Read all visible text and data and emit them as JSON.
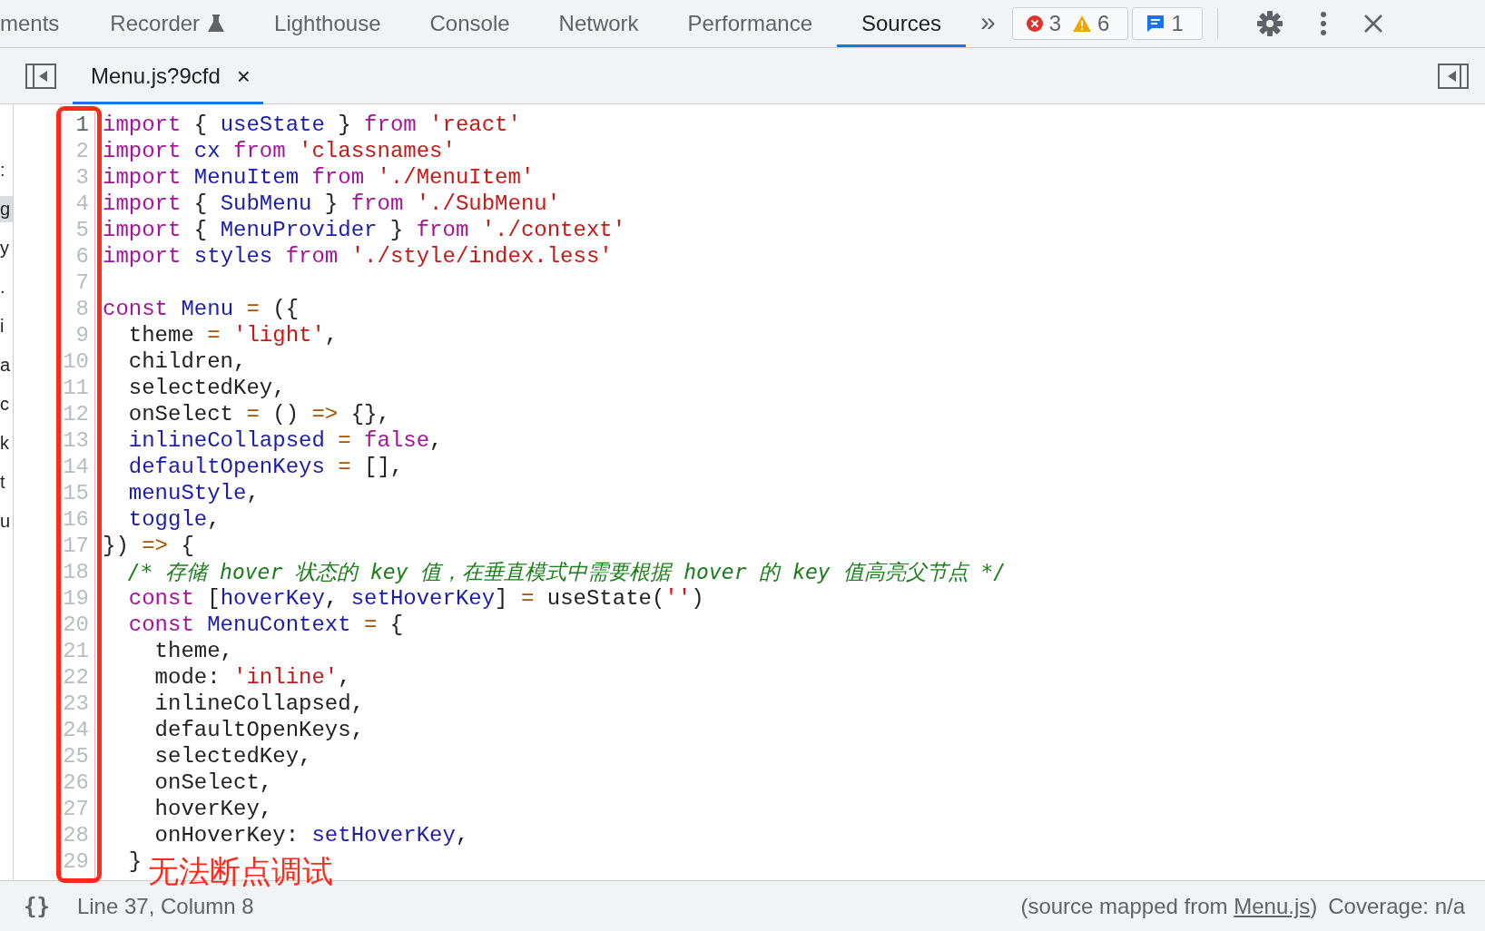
{
  "top_tabs": [
    {
      "label": "ments",
      "kind": "text",
      "selected": false
    },
    {
      "label": "Recorder",
      "kind": "flask",
      "selected": false
    },
    {
      "label": "Lighthouse",
      "kind": "text",
      "selected": false
    },
    {
      "label": "Console",
      "kind": "text",
      "selected": false
    },
    {
      "label": "Network",
      "kind": "text",
      "selected": false
    },
    {
      "label": "Performance",
      "kind": "text",
      "selected": false
    },
    {
      "label": "Sources",
      "kind": "text",
      "selected": true
    }
  ],
  "more_tabs": "»",
  "issues": {
    "errors": "3",
    "warnings": "6",
    "messages": "1"
  },
  "file_tabs": [
    {
      "label": "Menu.js?9cfd",
      "close": "×",
      "selected": true
    }
  ],
  "navigator_fragments": [
    {
      "text": ":",
      "selected": false
    },
    {
      "text": "g",
      "selected": true
    },
    {
      "text": "y",
      "selected": false
    },
    {
      "text": ".",
      "selected": false
    },
    {
      "text": "i",
      "selected": false
    },
    {
      "text": "a",
      "selected": false
    },
    {
      "text": "c",
      "selected": false
    },
    {
      "text": "k",
      "selected": false
    },
    {
      "text": "t",
      "selected": false
    },
    {
      "text": "u",
      "selected": false
    }
  ],
  "code_lines": [
    {
      "number": "1",
      "current": true,
      "tokens": [
        {
          "kind": "kw",
          "text": "import"
        },
        {
          "kind": "p",
          "text": " { "
        },
        {
          "kind": "def",
          "text": "useState"
        },
        {
          "kind": "p",
          "text": " } "
        },
        {
          "kind": "kw",
          "text": "from "
        },
        {
          "kind": "str",
          "text": "'react'"
        }
      ]
    },
    {
      "number": "2",
      "current": false,
      "tokens": [
        {
          "kind": "kw",
          "text": "import "
        },
        {
          "kind": "def",
          "text": "cx "
        },
        {
          "kind": "kw",
          "text": "from "
        },
        {
          "kind": "str",
          "text": "'classnames'"
        }
      ]
    },
    {
      "number": "3",
      "current": false,
      "tokens": [
        {
          "kind": "kw",
          "text": "import "
        },
        {
          "kind": "def",
          "text": "MenuItem "
        },
        {
          "kind": "kw",
          "text": "from "
        },
        {
          "kind": "str",
          "text": "'./MenuItem'"
        }
      ]
    },
    {
      "number": "4",
      "current": false,
      "tokens": [
        {
          "kind": "kw",
          "text": "import"
        },
        {
          "kind": "p",
          "text": " { "
        },
        {
          "kind": "def",
          "text": "SubMenu"
        },
        {
          "kind": "p",
          "text": " } "
        },
        {
          "kind": "kw",
          "text": "from "
        },
        {
          "kind": "str",
          "text": "'./SubMenu'"
        }
      ]
    },
    {
      "number": "5",
      "current": false,
      "tokens": [
        {
          "kind": "kw",
          "text": "import"
        },
        {
          "kind": "p",
          "text": " { "
        },
        {
          "kind": "def",
          "text": "MenuProvider"
        },
        {
          "kind": "p",
          "text": " } "
        },
        {
          "kind": "kw",
          "text": "from "
        },
        {
          "kind": "str",
          "text": "'./context'"
        }
      ]
    },
    {
      "number": "6",
      "current": false,
      "tokens": [
        {
          "kind": "kw",
          "text": "import "
        },
        {
          "kind": "def",
          "text": "styles "
        },
        {
          "kind": "kw",
          "text": "from "
        },
        {
          "kind": "str",
          "text": "'./style/index.less'"
        }
      ]
    },
    {
      "number": "7",
      "current": false
    },
    {
      "number": "8",
      "current": false,
      "tokens": [
        {
          "kind": "kw",
          "text": "const "
        },
        {
          "kind": "def",
          "text": "Menu "
        },
        {
          "kind": "op",
          "text": "="
        },
        {
          "kind": "p",
          "text": " ({"
        }
      ]
    },
    {
      "number": "9",
      "current": false,
      "tokens": [
        {
          "kind": "p",
          "text": "  theme "
        },
        {
          "kind": "op",
          "text": "= "
        },
        {
          "kind": "str",
          "text": "'light'"
        },
        {
          "kind": "p",
          "text": ","
        }
      ]
    },
    {
      "number": "10",
      "current": false,
      "tokens": [
        {
          "kind": "p",
          "text": "  children,"
        }
      ]
    },
    {
      "number": "11",
      "current": false,
      "tokens": [
        {
          "kind": "p",
          "text": "  selectedKey,"
        }
      ]
    },
    {
      "number": "12",
      "current": false,
      "tokens": [
        {
          "kind": "p",
          "text": "  onSelect "
        },
        {
          "kind": "op",
          "text": "="
        },
        {
          "kind": "p",
          "text": " () "
        },
        {
          "kind": "op",
          "text": "=>"
        },
        {
          "kind": "p",
          "text": " {},"
        }
      ]
    },
    {
      "number": "13",
      "current": false,
      "tokens": [
        {
          "kind": "def",
          "text": "  inlineCollapsed "
        },
        {
          "kind": "op",
          "text": "= "
        },
        {
          "kind": "kw",
          "text": "false"
        },
        {
          "kind": "p",
          "text": ","
        }
      ]
    },
    {
      "number": "14",
      "current": false,
      "tokens": [
        {
          "kind": "def",
          "text": "  defaultOpenKeys "
        },
        {
          "kind": "op",
          "text": "="
        },
        {
          "kind": "p",
          "text": " [],"
        }
      ]
    },
    {
      "number": "15",
      "current": false,
      "tokens": [
        {
          "kind": "def",
          "text": "  menuStyle"
        },
        {
          "kind": "p",
          "text": ","
        }
      ]
    },
    {
      "number": "16",
      "current": false,
      "tokens": [
        {
          "kind": "def",
          "text": "  toggle"
        },
        {
          "kind": "p",
          "text": ","
        }
      ]
    },
    {
      "number": "17",
      "current": false,
      "tokens": [
        {
          "kind": "p",
          "text": "}) "
        },
        {
          "kind": "op",
          "text": "=>"
        },
        {
          "kind": "p",
          "text": " {"
        }
      ]
    },
    {
      "number": "18",
      "current": false,
      "tokens": [
        {
          "kind": "cm",
          "text": "  /* 存储 hover 状态的 key 值，在垂直模式中需要根据 hover 的 key 值高亮父节点 */"
        }
      ]
    },
    {
      "number": "19",
      "current": false,
      "tokens": [
        {
          "kind": "kw",
          "text": "  const"
        },
        {
          "kind": "p",
          "text": " ["
        },
        {
          "kind": "def",
          "text": "hoverKey"
        },
        {
          "kind": "p",
          "text": ", "
        },
        {
          "kind": "def",
          "text": "setHoverKey"
        },
        {
          "kind": "p",
          "text": "] "
        },
        {
          "kind": "op",
          "text": "="
        },
        {
          "kind": "p",
          "text": " useState("
        },
        {
          "kind": "str",
          "text": "''"
        },
        {
          "kind": "p",
          "text": ")"
        }
      ]
    },
    {
      "number": "20",
      "current": false,
      "tokens": [
        {
          "kind": "kw",
          "text": "  const "
        },
        {
          "kind": "def",
          "text": "MenuContext "
        },
        {
          "kind": "op",
          "text": "="
        },
        {
          "kind": "p",
          "text": " {"
        }
      ]
    },
    {
      "number": "21",
      "current": false,
      "tokens": [
        {
          "kind": "p",
          "text": "    theme,"
        }
      ]
    },
    {
      "number": "22",
      "current": false,
      "tokens": [
        {
          "kind": "p",
          "text": "    mode: "
        },
        {
          "kind": "str",
          "text": "'inline'"
        },
        {
          "kind": "p",
          "text": ","
        }
      ]
    },
    {
      "number": "23",
      "current": false,
      "tokens": [
        {
          "kind": "p",
          "text": "    inlineCollapsed,"
        }
      ]
    },
    {
      "number": "24",
      "current": false,
      "tokens": [
        {
          "kind": "p",
          "text": "    defaultOpenKeys,"
        }
      ]
    },
    {
      "number": "25",
      "current": false,
      "tokens": [
        {
          "kind": "p",
          "text": "    selectedKey,"
        }
      ]
    },
    {
      "number": "26",
      "current": false,
      "tokens": [
        {
          "kind": "p",
          "text": "    onSelect,"
        }
      ]
    },
    {
      "number": "27",
      "current": false,
      "tokens": [
        {
          "kind": "p",
          "text": "    hoverKey,"
        }
      ]
    },
    {
      "number": "28",
      "current": false,
      "tokens": [
        {
          "kind": "p",
          "text": "    onHoverKey: "
        },
        {
          "kind": "def",
          "text": "setHoverKey"
        },
        {
          "kind": "p",
          "text": ","
        }
      ]
    },
    {
      "number": "29",
      "current": false,
      "tokens": [
        {
          "kind": "p",
          "text": "  }"
        }
      ]
    }
  ],
  "annotation": {
    "text": "无法断点调试"
  },
  "status_bar": {
    "format_button": "{}",
    "position": "Line 37, Column 8",
    "source_prefix": "(source mapped from ",
    "source_link": "Menu.js",
    "source_suffix": ")",
    "coverage": "Coverage: n/a"
  }
}
